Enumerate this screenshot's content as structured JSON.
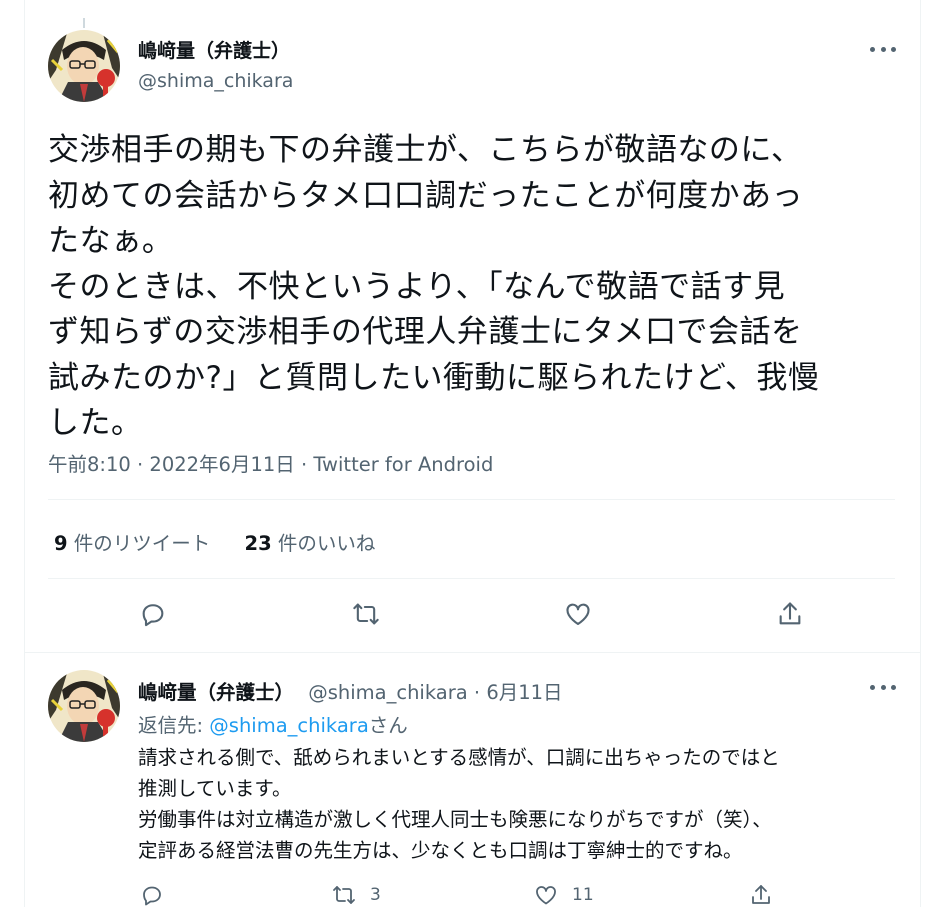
{
  "tweet": {
    "author_name": "嶋﨑量（弁護士）",
    "author_handle": "@shima_chikara",
    "text": "交渉相手の期も下の弁護士が、こちらが敬語なのに、\n初めての会話からタメ口口調だったことが何度かあっ\nたなぁ。\nそのときは、不快というより、「なんで敬語で話す見\nず知らずの交渉相手の代理人弁護士にタメ口で会話を\n試みたのか?」と質問したい衝動に駆られたけど、我慢\nした。",
    "time": "午前8:10",
    "date": "2022年6月11日",
    "separator": "·",
    "source": "Twitter for Android",
    "retweets_count": "9",
    "retweets_label": "件のリツイート",
    "likes_count": "23",
    "likes_label": "件のいいね"
  },
  "reply": {
    "author_name": "嶋﨑量（弁護士）",
    "author_handle": "@shima_chikara",
    "separator": "·",
    "date": "6月11日",
    "replying_prefix": "返信先:",
    "replying_mention": "@shima_chikara",
    "replying_suffix": "さん",
    "text": "請求される側で、舐められまいとする感情が、口調に出ちゃったのではと\n推測しています。\n労働事件は対立構造が激しく代理人同士も険悪になりがちですが（笑）、\n定評ある経営法曹の先生方は、少なくとも口調は丁寧紳士的ですね。",
    "retweet_count": "3",
    "like_count": "11"
  },
  "icons": {
    "more": "more-dots-icon",
    "reply": "reply-icon",
    "retweet": "retweet-icon",
    "like": "heart-icon",
    "share": "share-icon"
  },
  "colors": {
    "text": "#0f1419",
    "secondary": "#536471",
    "link": "#1d9bf0",
    "divider": "#eff3f4"
  }
}
